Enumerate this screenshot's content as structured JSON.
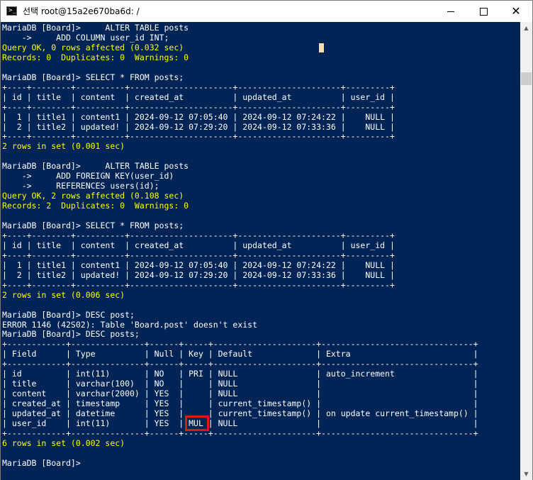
{
  "window": {
    "title": "선택 root@15a2e670ba6d: /",
    "controls": {
      "minimize": "minimize",
      "maximize": "maximize",
      "close": "✕"
    }
  },
  "colors": {
    "terminal_bg": "#012456",
    "text_white": "#ffffff",
    "text_yellow": "#ffff00",
    "highlight_border": "#e8141c",
    "cursor": "#f5deb3"
  },
  "terminal": {
    "lines": [
      {
        "text": "MariaDB [Board]>     ALTER TABLE posts",
        "color": "white"
      },
      {
        "text": "    ->     ADD COLUMN user_id INT;",
        "color": "white"
      },
      {
        "text": "Query OK, 0 rows affected (0.032 sec)",
        "color": "yellow"
      },
      {
        "text": "Records: 0  Duplicates: 0  Warnings: 0",
        "color": "yellow"
      },
      {
        "text": "",
        "color": "white"
      },
      {
        "text": "MariaDB [Board]> SELECT * FROM posts;",
        "color": "white"
      },
      {
        "text": "+----+--------+----------+---------------------+---------------------+---------+",
        "color": "white"
      },
      {
        "text": "| id | title  | content  | created_at          | updated_at          | user_id |",
        "color": "white"
      },
      {
        "text": "+----+--------+----------+---------------------+---------------------+---------+",
        "color": "white"
      },
      {
        "text": "|  1 | title1 | content1 | 2024-09-12 07:05:40 | 2024-09-12 07:24:22 |    NULL |",
        "color": "white"
      },
      {
        "text": "|  2 | title2 | updated! | 2024-09-12 07:29:20 | 2024-09-12 07:33:36 |    NULL |",
        "color": "white"
      },
      {
        "text": "+----+--------+----------+---------------------+---------------------+---------+",
        "color": "white"
      },
      {
        "text": "2 rows in set (0.001 sec)",
        "color": "yellow"
      },
      {
        "text": "",
        "color": "white"
      },
      {
        "text": "MariaDB [Board]>     ALTER TABLE posts",
        "color": "white"
      },
      {
        "text": "    ->     ADD FOREIGN KEY(user_id)",
        "color": "white"
      },
      {
        "text": "    ->     REFERENCES users(id);",
        "color": "white"
      },
      {
        "text": "Query OK, 2 rows affected (0.108 sec)",
        "color": "yellow"
      },
      {
        "text": "Records: 2  Duplicates: 0  Warnings: 0",
        "color": "yellow"
      },
      {
        "text": "",
        "color": "white"
      },
      {
        "text": "MariaDB [Board]> SELECT * FROM posts;",
        "color": "white"
      },
      {
        "text": "+----+--------+----------+---------------------+---------------------+---------+",
        "color": "white"
      },
      {
        "text": "| id | title  | content  | created_at          | updated_at          | user_id |",
        "color": "white"
      },
      {
        "text": "+----+--------+----------+---------------------+---------------------+---------+",
        "color": "white"
      },
      {
        "text": "|  1 | title1 | content1 | 2024-09-12 07:05:40 | 2024-09-12 07:24:22 |    NULL |",
        "color": "white"
      },
      {
        "text": "|  2 | title2 | updated! | 2024-09-12 07:29:20 | 2024-09-12 07:33:36 |    NULL |",
        "color": "white"
      },
      {
        "text": "+----+--------+----------+---------------------+---------------------+---------+",
        "color": "white"
      },
      {
        "text": "2 rows in set (0.006 sec)",
        "color": "yellow"
      },
      {
        "text": "",
        "color": "white"
      },
      {
        "text": "MariaDB [Board]> DESC post;",
        "color": "white"
      },
      {
        "text": "ERROR 1146 (42S02): Table 'Board.post' doesn't exist",
        "color": "white"
      },
      {
        "text": "MariaDB [Board]> DESC posts;",
        "color": "white"
      },
      {
        "text": "+------------+---------------+------+-----+---------------------+-------------------------------+",
        "color": "white"
      },
      {
        "text": "| Field      | Type          | Null | Key | Default             | Extra                         |",
        "color": "white"
      },
      {
        "text": "+------------+---------------+------+-----+---------------------+-------------------------------+",
        "color": "white"
      },
      {
        "text": "| id         | int(11)       | NO   | PRI | NULL                | auto_increment                |",
        "color": "white"
      },
      {
        "text": "| title      | varchar(100)  | NO   |     | NULL                |                               |",
        "color": "white"
      },
      {
        "text": "| content    | varchar(2000) | YES  |     | NULL                |                               |",
        "color": "white"
      },
      {
        "text": "| created_at | timestamp     | YES  |     | current_timestamp() |                               |",
        "color": "white"
      },
      {
        "text": "| updated_at | datetime      | YES  |     | current_timestamp() | on update current_timestamp() |",
        "color": "white"
      },
      {
        "text": "| user_id    | int(11)       | YES  | MUL | NULL                |                               |",
        "color": "white"
      },
      {
        "text": "+------------+---------------+------+-----+---------------------+-------------------------------+",
        "color": "white"
      },
      {
        "text": "6 rows in set (0.002 sec)",
        "color": "yellow"
      },
      {
        "text": "",
        "color": "white"
      },
      {
        "text": "MariaDB [Board]>",
        "color": "white"
      }
    ]
  }
}
